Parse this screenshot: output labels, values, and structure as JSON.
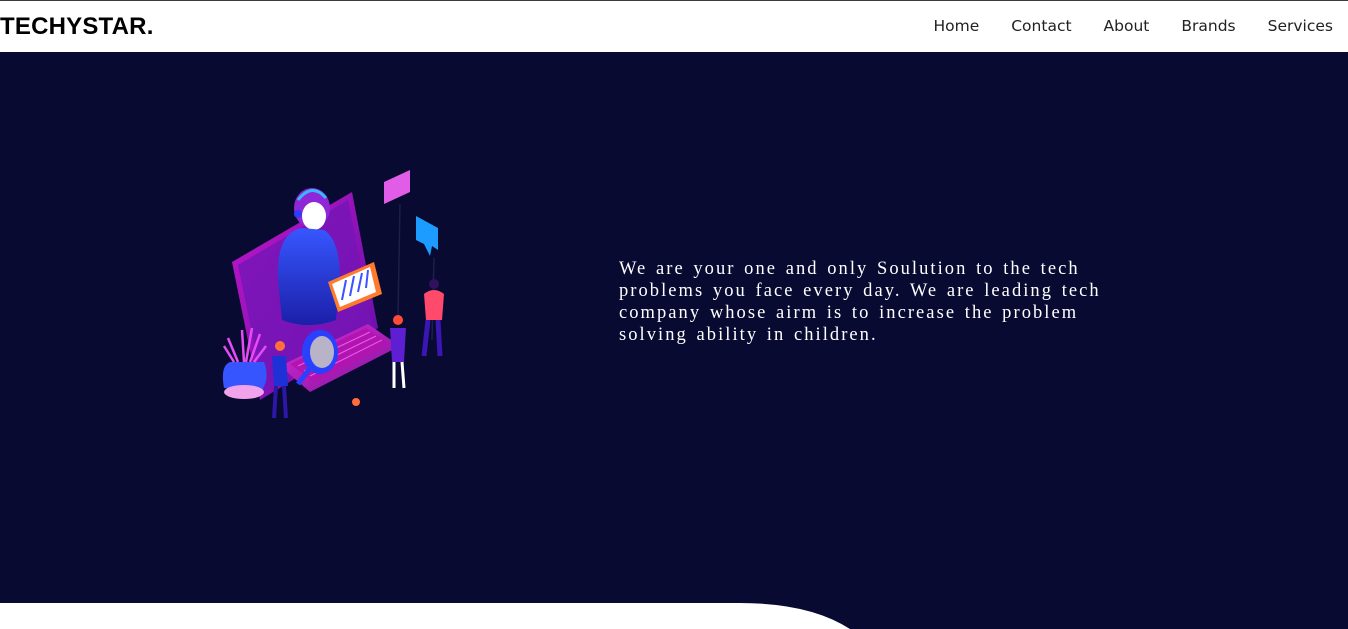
{
  "brand": {
    "logo_text": "TECHYSTAR."
  },
  "nav": {
    "items": [
      {
        "label": "Home"
      },
      {
        "label": "Contact"
      },
      {
        "label": "About"
      },
      {
        "label": "Brands"
      },
      {
        "label": "Services"
      }
    ]
  },
  "hero": {
    "description": "We are your one and only Soulution to the tech problems you face every day. We are leading tech company whose airm is to increase the problem solving ability in children.",
    "illustration_icon": "tech-support-isometric-illustration"
  },
  "colors": {
    "hero_background": "#080a31",
    "navbar_background": "#ffffff",
    "text_light": "#ffffff"
  }
}
